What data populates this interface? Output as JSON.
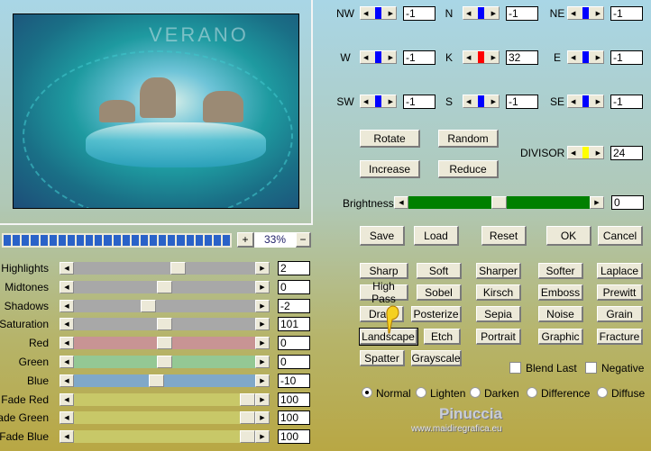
{
  "preview": {
    "watermark": "VERANO"
  },
  "zoom": {
    "plus": "+",
    "minus": "−",
    "value": "33%",
    "progress": 1.0
  },
  "matrix": {
    "cells": [
      {
        "label": "NW",
        "value": "-1",
        "color": "#0000ff"
      },
      {
        "label": "N",
        "value": "-1",
        "color": "#0000ff"
      },
      {
        "label": "NE",
        "value": "-1",
        "color": "#0000ff"
      },
      {
        "label": "W",
        "value": "-1",
        "color": "#0000ff"
      },
      {
        "label": "K",
        "value": "32",
        "color": "#ff0000"
      },
      {
        "label": "E",
        "value": "-1",
        "color": "#0000ff"
      },
      {
        "label": "SW",
        "value": "-1",
        "color": "#0000ff"
      },
      {
        "label": "S",
        "value": "-1",
        "color": "#0000ff"
      },
      {
        "label": "SE",
        "value": "-1",
        "color": "#0000ff"
      }
    ],
    "divisor": {
      "label": "DIVISOR",
      "value": "24",
      "color": "#ffff00"
    }
  },
  "buttons": {
    "rotate": "Rotate",
    "random": "Random",
    "increase": "Increase",
    "reduce": "Reduce",
    "save": "Save",
    "load": "Load",
    "reset": "Reset",
    "ok": "OK",
    "cancel": "Cancel"
  },
  "brightness": {
    "label": "Brightness",
    "value": "0",
    "color": "#008000"
  },
  "presets": [
    "Sharp",
    "Soft",
    "Sharper",
    "Softer",
    "Laplace",
    "High Pass",
    "Sobel",
    "Kirsch",
    "Emboss",
    "Prewitt",
    "Draw",
    "Posterize",
    "Sepia",
    "Noise",
    "Grain",
    "Landscape",
    "Etch",
    "Portrait",
    "Graphic",
    "Fracture",
    "Spatter",
    "Grayscale"
  ],
  "checkboxes": {
    "blend_last": "Blend Last",
    "negative": "Negative"
  },
  "modes": {
    "selected": "Normal",
    "options": [
      "Normal",
      "Lighten",
      "Darken",
      "Difference",
      "Diffuse"
    ]
  },
  "credit": {
    "name": "Pinuccia",
    "url": "www.maidiregrafica.eu"
  },
  "sliders": [
    {
      "label": "Highlights",
      "value": "2",
      "color": "#a8a8a8",
      "pos": 0.58
    },
    {
      "label": "Midtones",
      "value": "0",
      "color": "#a8a8a8",
      "pos": 0.5
    },
    {
      "label": "Shadows",
      "value": "-2",
      "color": "#a8a8a8",
      "pos": 0.4
    },
    {
      "label": "Saturation",
      "value": "101",
      "color": "#a8a8a8",
      "pos": 0.5
    },
    {
      "label": "Red",
      "value": "0",
      "color": "#c89494",
      "pos": 0.5
    },
    {
      "label": "Green",
      "value": "0",
      "color": "#94c894",
      "pos": 0.5
    },
    {
      "label": "Blue",
      "value": "-10",
      "color": "#80a8c8",
      "pos": 0.45
    },
    {
      "label": "Fade Red",
      "value": "100",
      "color": "#c8c868",
      "pos": 1.0
    },
    {
      "label": "Fade Green",
      "value": "100",
      "color": "#c8c868",
      "pos": 1.0
    },
    {
      "label": "Fade Blue",
      "value": "100",
      "color": "#c8c868",
      "pos": 1.0
    }
  ]
}
